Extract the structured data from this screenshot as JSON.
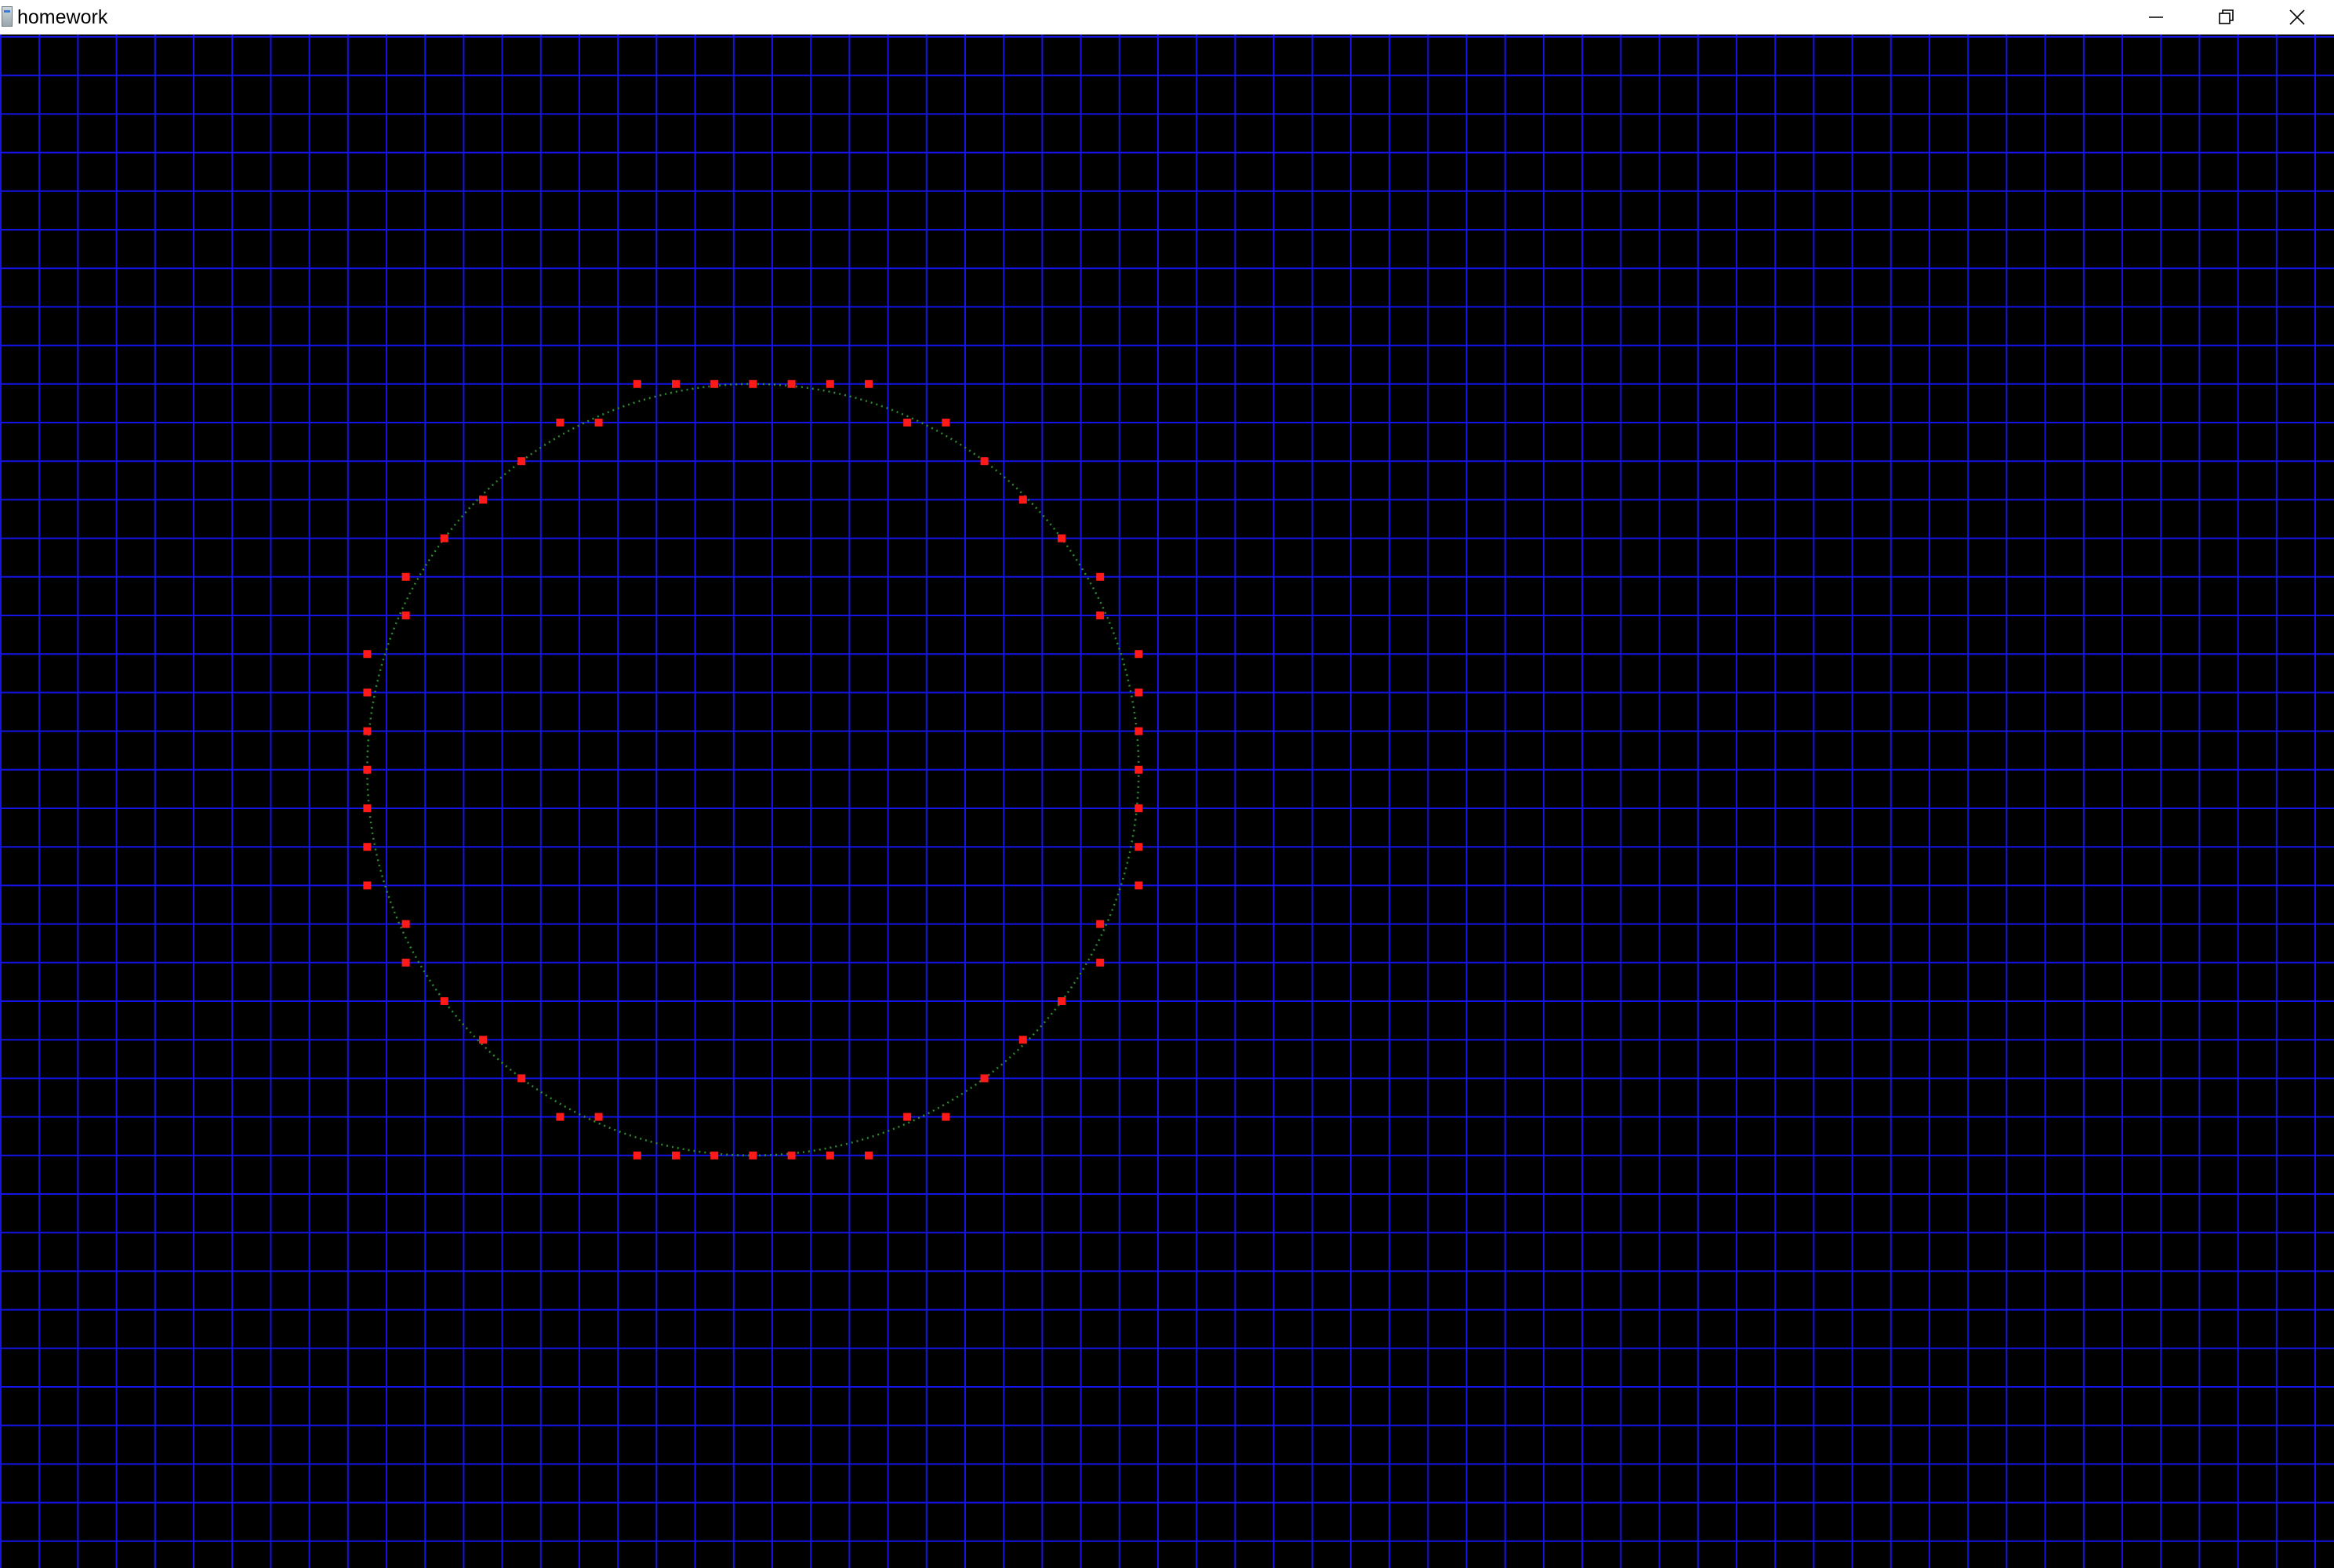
{
  "window": {
    "title": "homework",
    "controls": {
      "minimize": "minimize",
      "restore": "restore",
      "close": "close"
    }
  },
  "colors": {
    "background": "#000000",
    "grid": "#1414e6",
    "circle_curve": "#2e8b2e",
    "control_points": "#ff1a1a"
  },
  "scene": {
    "grid_columns": 60,
    "grid_rows": 40,
    "circle": {
      "center": [
        19.5,
        19
      ],
      "radius": 10
    }
  }
}
